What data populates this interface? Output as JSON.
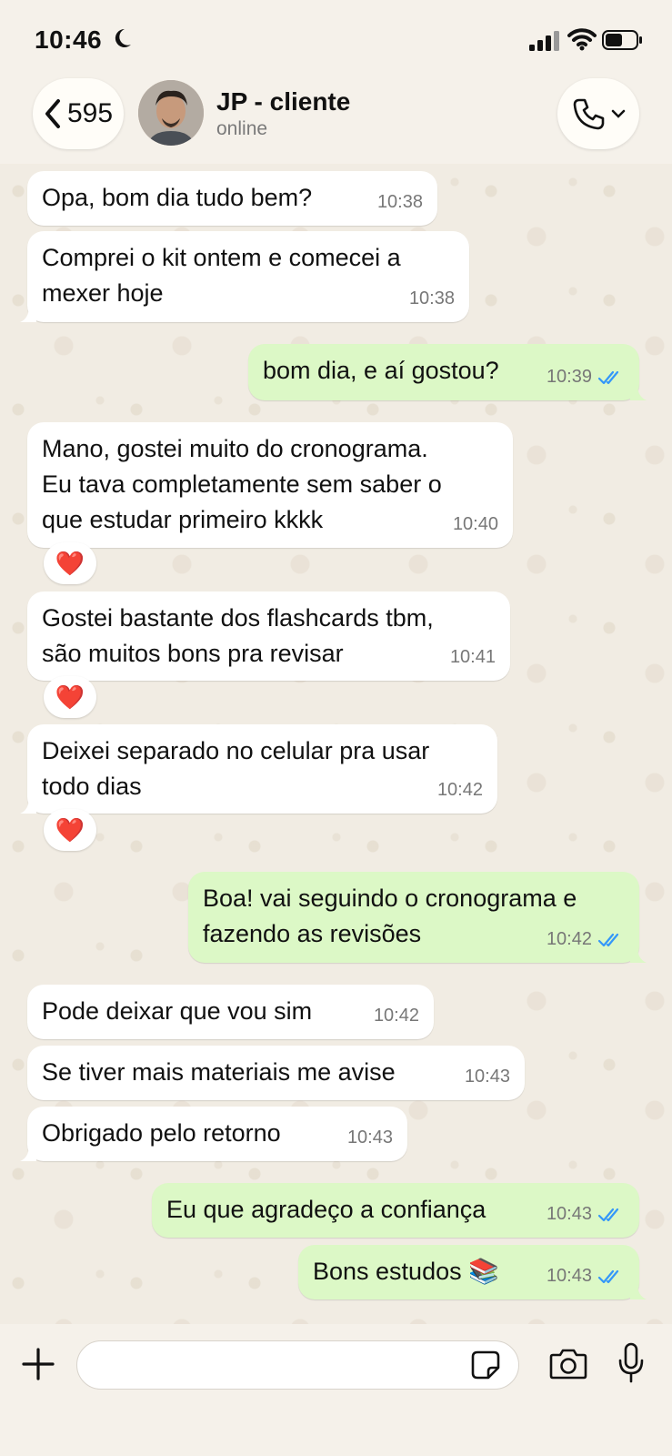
{
  "status_bar": {
    "time": "10:46"
  },
  "header": {
    "back_count": "595",
    "contact_name": "JP - cliente",
    "contact_status": "online"
  },
  "messages": [
    {
      "dir": "in",
      "text": "Opa, bom dia tudo bem?",
      "time": "10:38"
    },
    {
      "dir": "in",
      "text": "Comprei o kit ontem e comecei a\nmexer hoje",
      "time": "10:38"
    },
    {
      "dir": "out",
      "text": "bom dia, e aí gostou?",
      "time": "10:39"
    },
    {
      "dir": "in",
      "text": "Mano, gostei muito do cronograma.\nEu tava completamente sem saber o\nque estudar primeiro kkkk",
      "time": "10:40",
      "reaction": "❤️"
    },
    {
      "dir": "in",
      "text": "Gostei bastante dos flashcards tbm,\nsão muitos bons pra revisar",
      "time": "10:41",
      "reaction": "❤️"
    },
    {
      "dir": "in",
      "text": "Deixei separado no celular pra usar\ntodo dias",
      "time": "10:42",
      "reaction": "❤️"
    },
    {
      "dir": "out",
      "text": "Boa! vai seguindo o cronograma e\nfazendo as revisões",
      "time": "10:42"
    },
    {
      "dir": "in",
      "text": "Pode deixar que vou sim",
      "time": "10:42"
    },
    {
      "dir": "in",
      "text": "Se tiver mais materiais me avise",
      "time": "10:43"
    },
    {
      "dir": "in",
      "text": "Obrigado pelo retorno",
      "time": "10:43"
    },
    {
      "dir": "out",
      "text": "Eu que agradeço a confiança",
      "time": "10:43"
    },
    {
      "dir": "out",
      "text": "Bons estudos 📚",
      "time": "10:43"
    }
  ],
  "colors": {
    "incoming": "#ffffff",
    "outgoing": "#dcf8c6",
    "read_ticks": "#3497f9",
    "reaction_heart": "#e0202a"
  },
  "input": {
    "placeholder": ""
  }
}
